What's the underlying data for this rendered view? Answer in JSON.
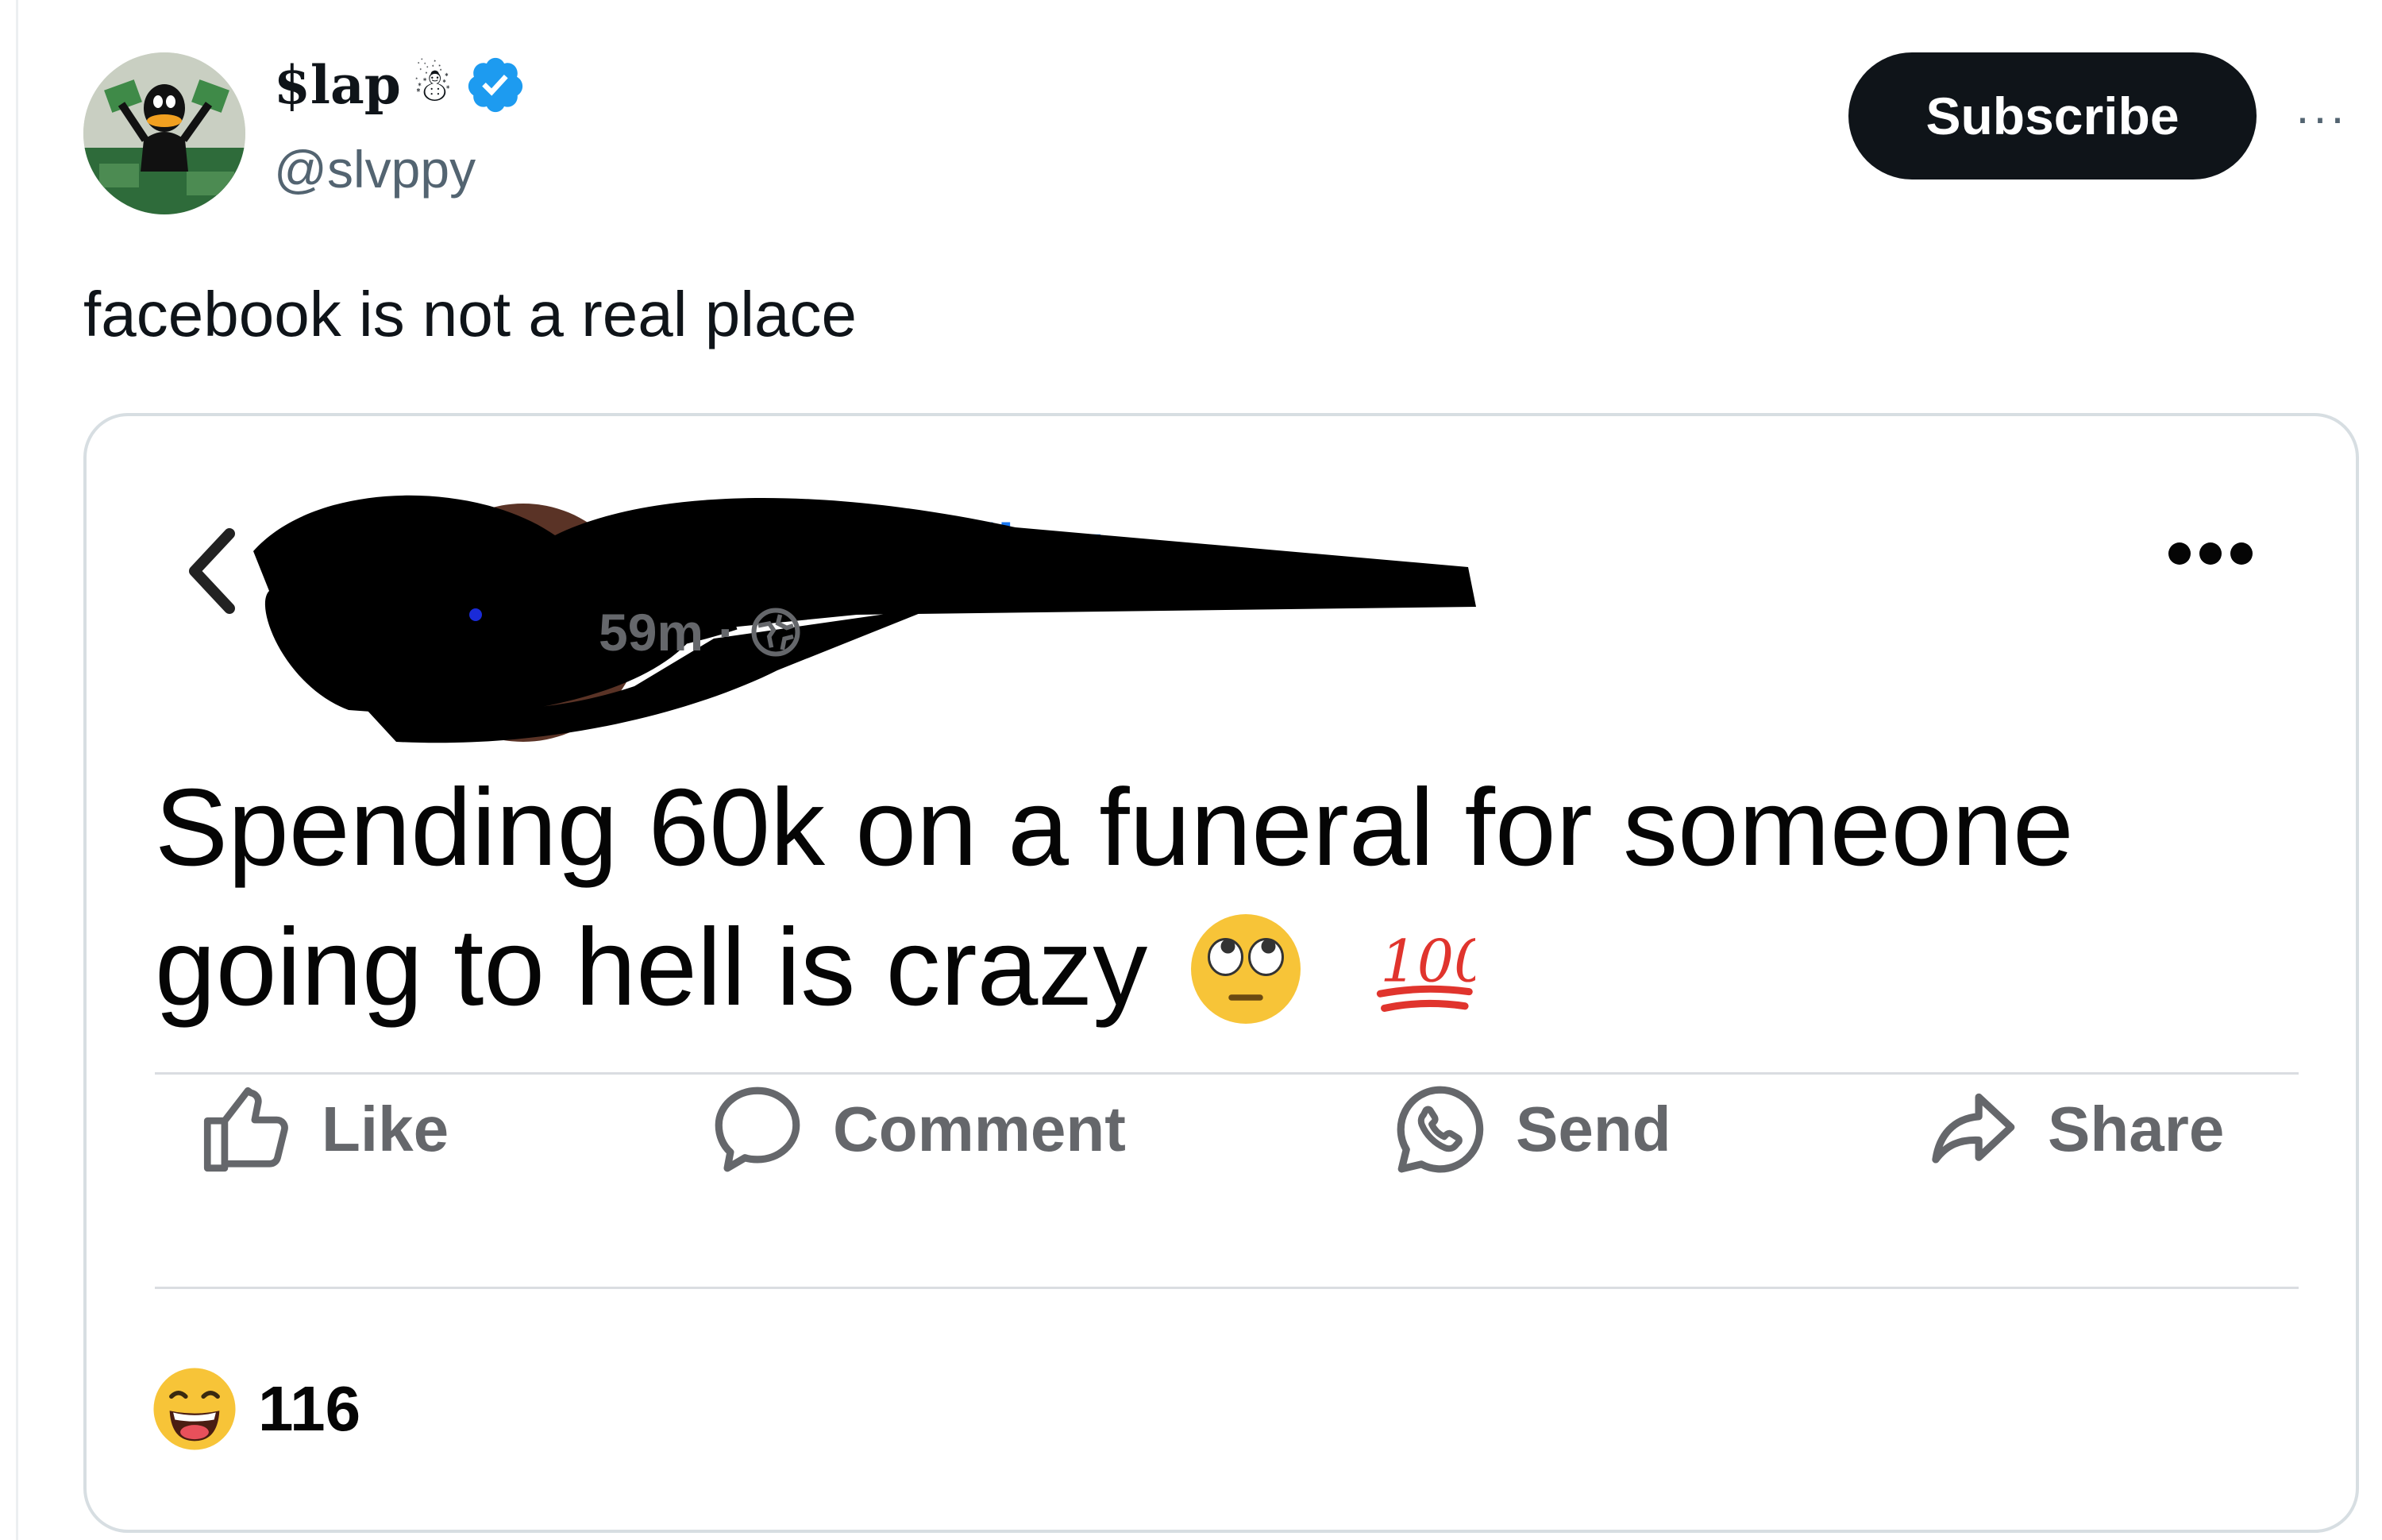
{
  "tweet": {
    "author": {
      "display_name": "$lap",
      "display_emoji": "☃",
      "handle": "@slvppy",
      "avatar_icon": "daffy-duck-money-avatar",
      "verified_icon": "verified-badge-icon"
    },
    "subscribe_label": "Subscribe",
    "more_icon": "ellipsis-icon",
    "text": "facebook is not a real place"
  },
  "embedded_post": {
    "author_name": "[redacted]",
    "timestamp": "59m",
    "separator": "·",
    "audience_icon": "globe-icon",
    "text": "Spending 60k on a funeral for someone going to hell is crazy",
    "emojis": [
      "face-with-rolling-eyes",
      "hundred-points"
    ],
    "actions": [
      {
        "label": "Like",
        "icon": "thumbs-up-icon"
      },
      {
        "label": "Comment",
        "icon": "comment-bubble-icon"
      },
      {
        "label": "Send",
        "icon": "whatsapp-icon"
      },
      {
        "label": "Share",
        "icon": "share-arrow-icon"
      }
    ],
    "reaction": {
      "icon": "haha-emoji-icon",
      "count": "116"
    }
  },
  "colors": {
    "subscribe_bg": "#0f1419",
    "handle": "#536471",
    "fb_gray": "#65676b",
    "verified": "#1d9bf0"
  }
}
